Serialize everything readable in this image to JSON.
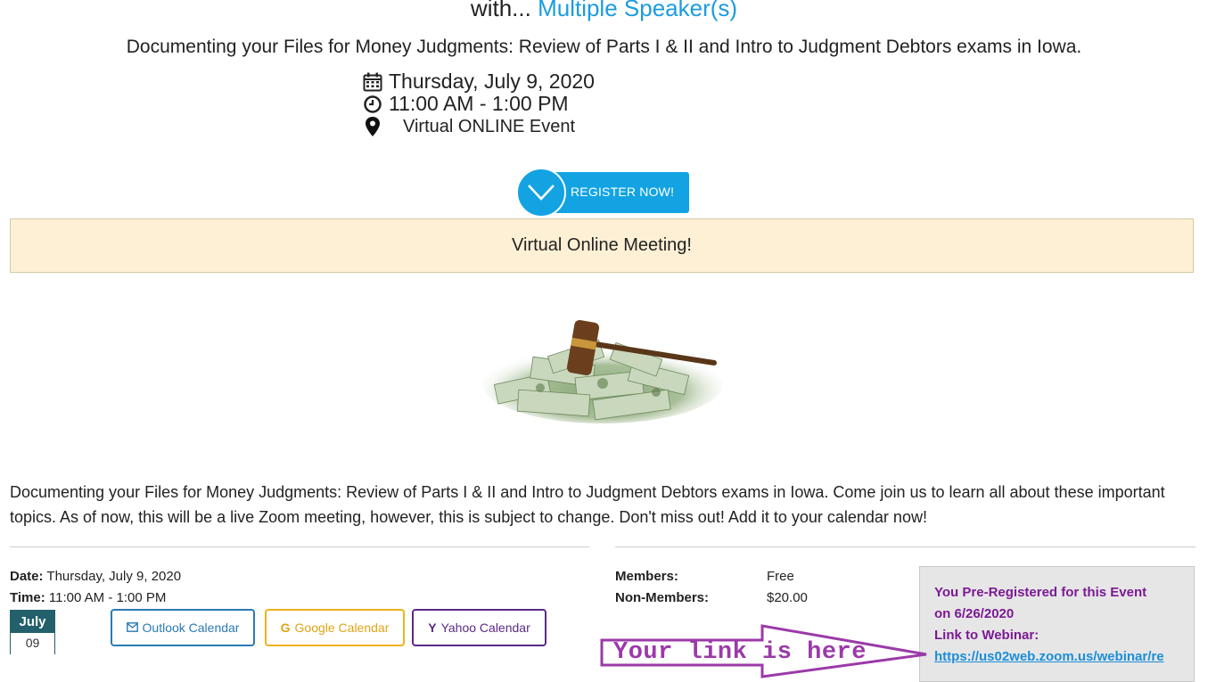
{
  "header": {
    "prefix": "with...",
    "speaker_link": "Multiple Speaker(s)",
    "title": "Documenting your Files for Money Judgments: Review of Parts I & II and Intro to Judgment Debtors exams in Iowa."
  },
  "event_meta": {
    "date": "Thursday, July 9, 2020",
    "time": "11:00 AM - 1:00 PM",
    "location": "Virtual ONLINE Event",
    "icons": [
      "calendar-icon",
      "clock-icon",
      "map-pin-icon"
    ]
  },
  "register_button": {
    "label": "REGISTER NOW!",
    "color": "#13a3e3"
  },
  "notice": {
    "text": "Virtual Online Meeting!",
    "background": "#fdf0d5"
  },
  "description": "Documenting your Files for Money Judgments: Review of Parts I & II  and Intro to Judgment Debtors exams in Iowa. Come join us to learn all about these important topics. As of now, this will be a live Zoom meeting, however, this is subject to change.  Don't miss out!  Add it to your calendar now!",
  "details": {
    "date_label": "Date:",
    "date_value": "Thursday, July 9, 2020",
    "time_label": "Time:",
    "time_value": "11:00 AM - 1:00 PM",
    "badge_month": "July",
    "badge_day": "09"
  },
  "calendar_buttons": {
    "outlook": "Outlook Calendar",
    "google": "Google Calendar",
    "yahoo": "Yahoo Calendar"
  },
  "pricing": {
    "members_label": "Members:",
    "members_value": "Free",
    "nonmembers_label": "Non-Members:",
    "nonmembers_value": "$20.00"
  },
  "prereg": {
    "line1": "You Pre-Registered for this Event",
    "line2": "on 6/26/2020",
    "line3": "Link to Webinar:",
    "link_text": "https://us02web.zoom.us/webinar/re"
  },
  "annotation": {
    "text": "Your link is here",
    "color": "#9b3aa8"
  }
}
